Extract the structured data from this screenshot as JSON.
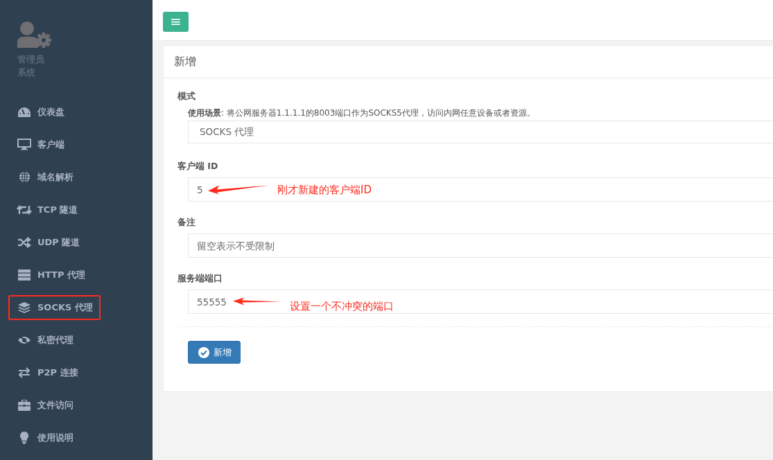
{
  "sidebar": {
    "profile": {
      "name": "管理员",
      "role": "系统"
    },
    "items": [
      {
        "label": "仪表盘",
        "boxed": false
      },
      {
        "label": "客户端",
        "boxed": false
      },
      {
        "label": "域名解析",
        "boxed": false
      },
      {
        "label": "TCP 隧道",
        "boxed": false
      },
      {
        "label": "UDP 隧道",
        "boxed": false
      },
      {
        "label": "HTTP 代理",
        "boxed": false
      },
      {
        "label": "SOCKS 代理",
        "boxed": true
      },
      {
        "label": "私密代理",
        "boxed": false
      },
      {
        "label": "P2P 连接",
        "boxed": false
      },
      {
        "label": "文件访问",
        "boxed": false
      },
      {
        "label": "使用说明",
        "boxed": false
      }
    ]
  },
  "topbar": {
    "menu_button": "≡"
  },
  "card": {
    "title": "新增",
    "fields": [
      {
        "kind": "select",
        "label": "模式",
        "help": "**使用场景**: 将公网服务器1.1.1.1的8003端口作为SOCKS5代理，访问内网任意设备或者资源。",
        "value": "SOCKS 代理"
      },
      {
        "kind": "input",
        "label": "客户端 ID",
        "value": "5",
        "annotation": "刚才新建的客户端ID"
      },
      {
        "kind": "input",
        "label": "备注",
        "placeholder": "留空表示不受限制"
      },
      {
        "kind": "input",
        "label": "服务端端口",
        "value": "55555",
        "annotation": "设置一个不冲突的端口"
      }
    ],
    "submit": "新增"
  }
}
